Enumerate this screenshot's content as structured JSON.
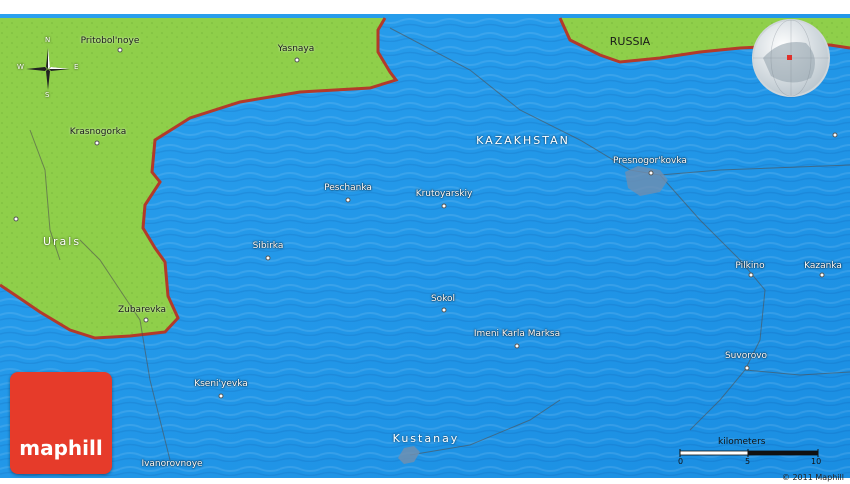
{
  "map": {
    "colors": {
      "water": "#1e96e8",
      "land": "#8fcf4a",
      "border": "#c0392b",
      "logo": "#e63b2a"
    },
    "countries": {
      "kazakhstan": "KAZAKHSTAN",
      "russia": "RUSSIA"
    },
    "regions": {
      "urals": "Urals"
    },
    "cities": [
      {
        "name": "Pritobol'noye",
        "key": "pritobolnoye"
      },
      {
        "name": "Yasnaya",
        "key": "yasnaya"
      },
      {
        "name": "Krasnogorka",
        "key": "krasnogorka"
      },
      {
        "name": "Peschanka",
        "key": "peschanka"
      },
      {
        "name": "Krutoyarskiy",
        "key": "krutoyarskiy"
      },
      {
        "name": "Presnogor'kovka",
        "key": "presnogorkovka"
      },
      {
        "name": "Sibirka",
        "key": "sibirka"
      },
      {
        "name": "Pilkino",
        "key": "pilkino"
      },
      {
        "name": "Kazanka",
        "key": "kazanka"
      },
      {
        "name": "Sokol",
        "key": "sokol"
      },
      {
        "name": "Zubarevka",
        "key": "zubarevka"
      },
      {
        "name": "Imeni Karla Marksa",
        "key": "imeni-karla-marksa"
      },
      {
        "name": "Suvorovo",
        "key": "suvorovo"
      },
      {
        "name": "Kseni'yevka",
        "key": "kseniyevka"
      },
      {
        "name": "Kustanay",
        "key": "kustanay"
      },
      {
        "name": "Ivanorovnoye",
        "key": "ivanorovnoye"
      }
    ],
    "compass": {
      "n": "N",
      "s": "S",
      "e": "E",
      "w": "W"
    },
    "scale": {
      "title": "kilometers",
      "ticks": [
        "0",
        "5",
        "10"
      ]
    },
    "logo_text": "maphill",
    "copyright": "© 2011 Maphill"
  }
}
